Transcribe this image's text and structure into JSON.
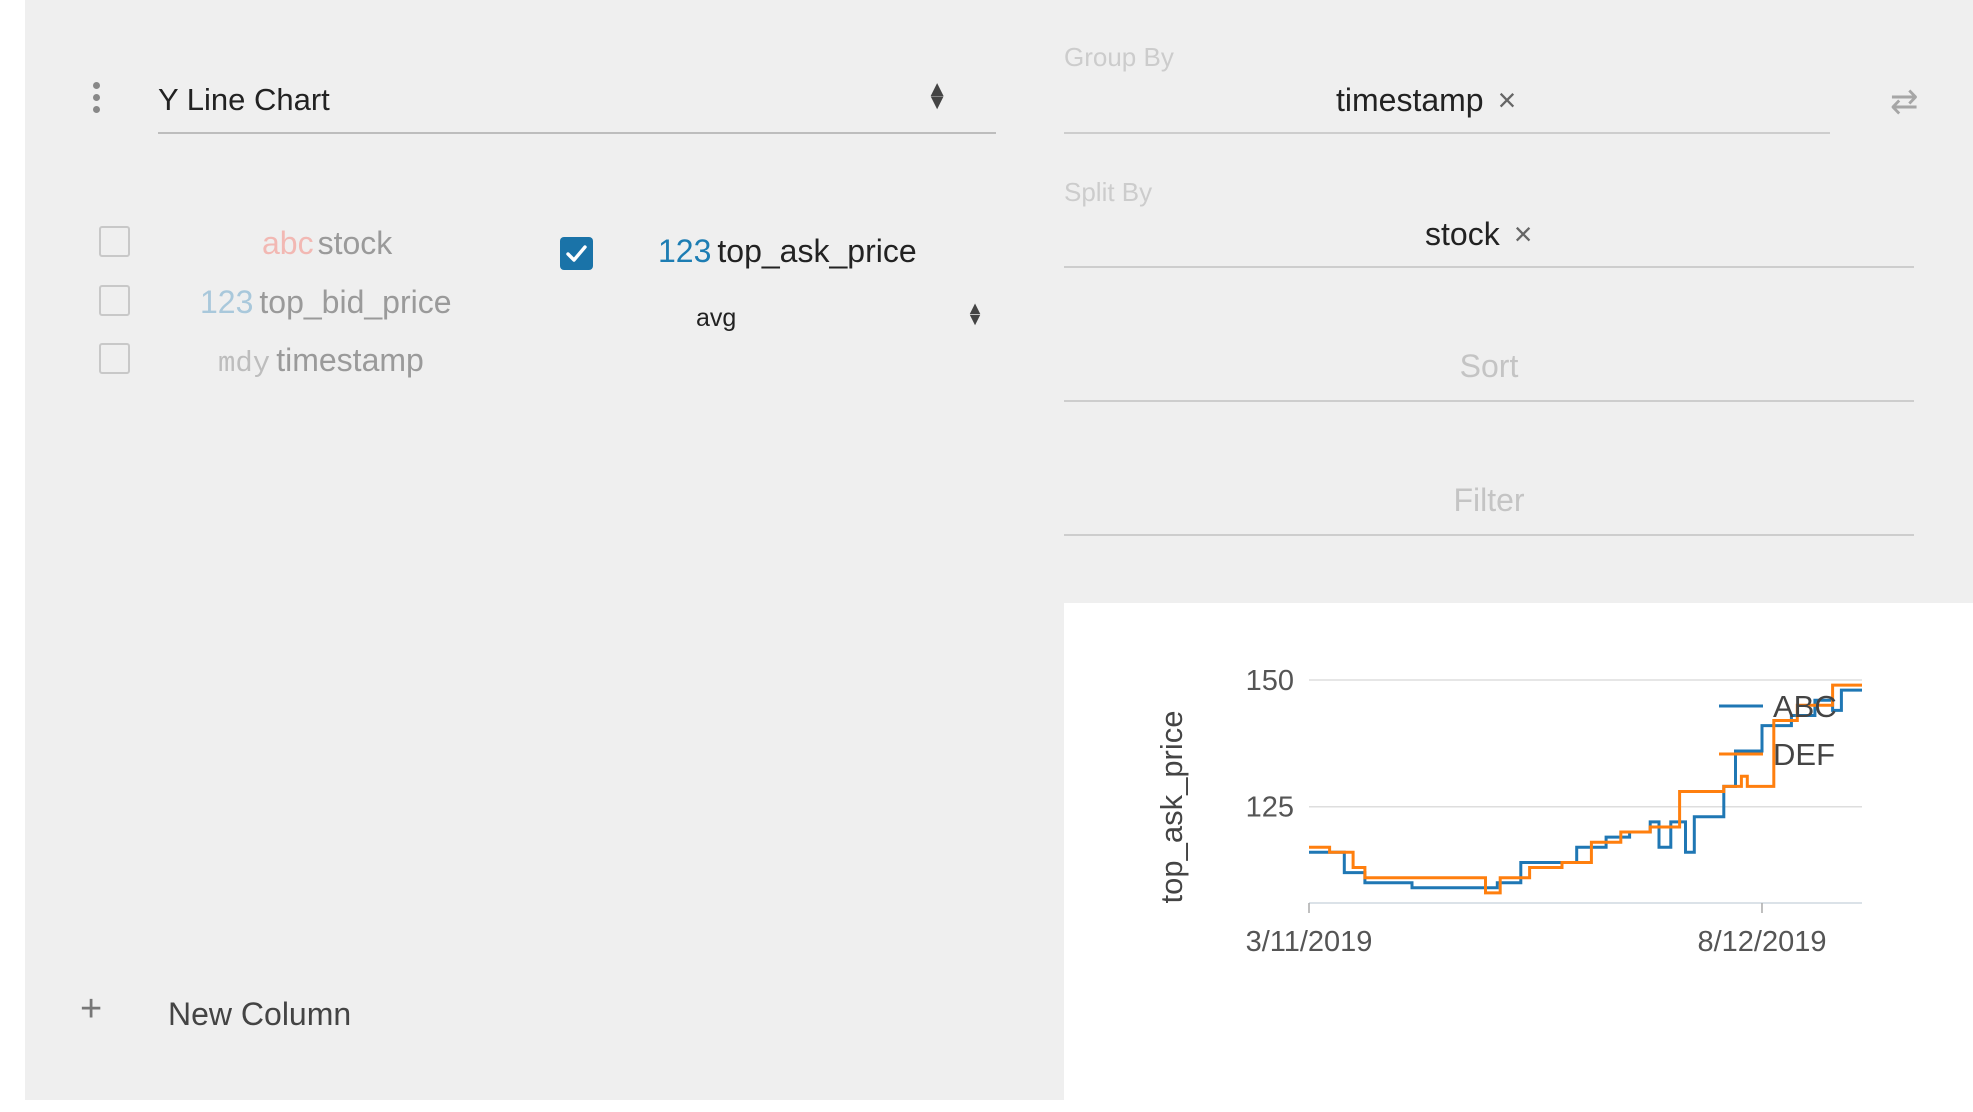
{
  "plugin": {
    "selected": "Y Line Chart"
  },
  "columns": {
    "inactive": [
      {
        "type_label": "abc",
        "name": "stock",
        "type": "string"
      },
      {
        "type_label": "123",
        "name": "top_bid_price",
        "type": "number"
      },
      {
        "type_label": "mdy",
        "name": "timestamp",
        "type": "date"
      }
    ],
    "active": [
      {
        "type_label": "123",
        "name": "top_ask_price",
        "aggregate": "avg"
      }
    ]
  },
  "new_column": {
    "label": "New Column"
  },
  "config": {
    "group_by": {
      "title": "Group By",
      "value": "timestamp"
    },
    "split_by": {
      "title": "Split By",
      "value": "stock"
    },
    "sort": {
      "placeholder": "Sort"
    },
    "filter": {
      "placeholder": "Filter"
    }
  },
  "icons": {
    "menu": "vertical-dots-icon",
    "swap": "swap-arrows-icon",
    "remove": "close-icon",
    "check": "check-icon",
    "select": "updown-caret-icon",
    "add": "plus-icon"
  },
  "colors": {
    "accent": "#1a73a8",
    "series_abc": "#1f77b4",
    "series_def": "#ff7f0e"
  },
  "chart_data": {
    "type": "line",
    "ylabel": "top_ask_price",
    "xlabel": "",
    "x_ticks": [
      "3/11/2019",
      "8/12/2019"
    ],
    "y_ticks": [
      125,
      150
    ],
    "xlim": [
      "2019-03-11",
      "2019-09-15"
    ],
    "ylim": [
      106,
      150
    ],
    "legend": "top-right",
    "series": [
      {
        "name": "ABC",
        "points": [
          [
            "2019-03-11",
            116
          ],
          [
            "2019-03-20",
            116
          ],
          [
            "2019-03-23",
            112
          ],
          [
            "2019-03-30",
            110
          ],
          [
            "2019-04-15",
            109
          ],
          [
            "2019-05-10",
            109
          ],
          [
            "2019-05-14",
            110
          ],
          [
            "2019-05-22",
            114
          ],
          [
            "2019-06-05",
            114
          ],
          [
            "2019-06-10",
            117
          ],
          [
            "2019-06-20",
            119
          ],
          [
            "2019-06-28",
            120
          ],
          [
            "2019-07-05",
            122
          ],
          [
            "2019-07-08",
            117
          ],
          [
            "2019-07-12",
            122
          ],
          [
            "2019-07-17",
            116
          ],
          [
            "2019-07-20",
            123
          ],
          [
            "2019-07-27",
            123
          ],
          [
            "2019-07-30",
            129
          ],
          [
            "2019-08-03",
            136
          ],
          [
            "2019-08-12",
            141
          ],
          [
            "2019-08-20",
            141
          ],
          [
            "2019-08-22",
            143
          ],
          [
            "2019-08-30",
            146
          ],
          [
            "2019-09-05",
            144
          ],
          [
            "2019-09-08",
            148
          ],
          [
            "2019-09-15",
            148
          ]
        ]
      },
      {
        "name": "DEF",
        "points": [
          [
            "2019-03-11",
            117
          ],
          [
            "2019-03-18",
            116
          ],
          [
            "2019-03-26",
            113
          ],
          [
            "2019-03-30",
            111
          ],
          [
            "2019-05-05",
            111
          ],
          [
            "2019-05-10",
            108
          ],
          [
            "2019-05-15",
            111
          ],
          [
            "2019-05-25",
            113
          ],
          [
            "2019-06-05",
            114
          ],
          [
            "2019-06-15",
            118
          ],
          [
            "2019-06-25",
            120
          ],
          [
            "2019-07-05",
            121
          ],
          [
            "2019-07-15",
            128
          ],
          [
            "2019-07-30",
            129
          ],
          [
            "2019-08-05",
            131
          ],
          [
            "2019-08-07",
            129
          ],
          [
            "2019-08-12",
            129
          ],
          [
            "2019-08-16",
            142
          ],
          [
            "2019-08-24",
            145
          ],
          [
            "2019-08-31",
            145
          ],
          [
            "2019-09-05",
            149
          ],
          [
            "2019-09-15",
            149
          ]
        ]
      }
    ]
  }
}
